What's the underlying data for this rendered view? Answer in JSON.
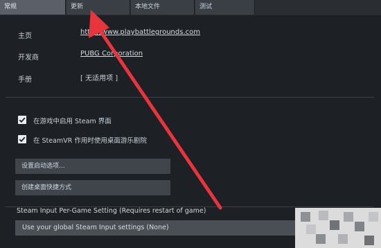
{
  "tabs": [
    {
      "label": "常规"
    },
    {
      "label": "更新"
    },
    {
      "label": "本地文件"
    },
    {
      "label": "测试"
    }
  ],
  "info": {
    "homepage_label": "主页",
    "homepage_value": "http://www.playbattlegrounds.com",
    "developer_label": "开发商",
    "developer_value": "PUBG Corporation",
    "manual_label": "手册",
    "manual_value": "[ 无适用项 ]"
  },
  "checkboxes": [
    {
      "label": "在游戏中启用 Steam 界面",
      "checked": true
    },
    {
      "label": "在 SteamVR 作用时使用桌面游乐剧院",
      "checked": true
    }
  ],
  "buttons": {
    "launch_options": "设置启动选项...",
    "desktop_shortcut": "创建桌面快捷方式"
  },
  "steam_input": {
    "title": "Steam Input Per-Game Setting (Requires restart of game)",
    "selected": "Use your global Steam Input settings (None)"
  },
  "colors": {
    "background": "#1d2024",
    "arrow": "#e8343c",
    "tab_active": "#5b6068",
    "button": "#40454c"
  }
}
